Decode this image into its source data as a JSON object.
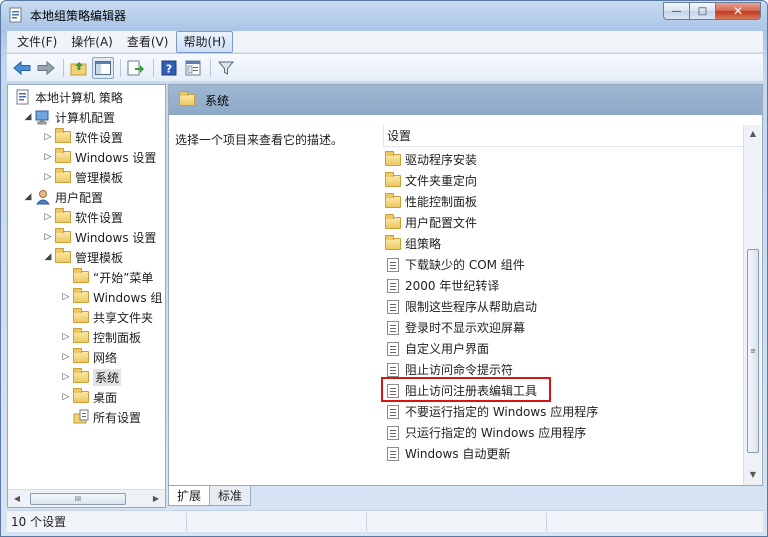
{
  "window": {
    "title": "本地组策略编辑器",
    "minimize_glyph": "—",
    "maximize_glyph": "□",
    "close_glyph": "✕"
  },
  "menubar": {
    "items": [
      "文件(F)",
      "操作(A)",
      "查看(V)",
      "帮助(H)"
    ]
  },
  "toolbar": {
    "icons": [
      "back-icon",
      "forward-icon",
      "up-folder-icon",
      "show-hide-tree-icon",
      "export-list-icon",
      "help-icon",
      "properties-icon",
      "filter-icon"
    ]
  },
  "tree": {
    "items": [
      {
        "label": "本地计算机 策略",
        "icon": "policy-doc-icon",
        "level": 0,
        "expanded": null
      },
      {
        "label": "计算机配置",
        "icon": "computer-icon",
        "level": 1,
        "expanded": true
      },
      {
        "label": "软件设置",
        "icon": "folder-icon",
        "level": 2,
        "expanded": false
      },
      {
        "label": "Windows 设置",
        "icon": "folder-icon",
        "level": 2,
        "expanded": false
      },
      {
        "label": "管理模板",
        "icon": "folder-icon",
        "level": 2,
        "expanded": false
      },
      {
        "label": "用户配置",
        "icon": "user-icon",
        "level": 1,
        "expanded": true
      },
      {
        "label": "软件设置",
        "icon": "folder-icon",
        "level": 2,
        "expanded": false
      },
      {
        "label": "Windows 设置",
        "icon": "folder-icon",
        "level": 2,
        "expanded": false
      },
      {
        "label": "管理模板",
        "icon": "folder-icon",
        "level": 2,
        "expanded": true
      },
      {
        "label": "“开始”菜单",
        "icon": "folder-icon",
        "level": 3,
        "expanded": null
      },
      {
        "label": "Windows 组",
        "icon": "folder-icon",
        "level": 3,
        "expanded": false
      },
      {
        "label": "共享文件夹",
        "icon": "folder-icon",
        "level": 3,
        "expanded": null
      },
      {
        "label": "控制面板",
        "icon": "folder-icon",
        "level": 3,
        "expanded": false
      },
      {
        "label": "网络",
        "icon": "folder-icon",
        "level": 3,
        "expanded": false
      },
      {
        "label": "系统",
        "icon": "folder-icon",
        "level": 3,
        "expanded": false,
        "selected": true
      },
      {
        "label": "桌面",
        "icon": "folder-icon",
        "level": 3,
        "expanded": false
      },
      {
        "label": "所有设置",
        "icon": "all-settings-icon",
        "level": 3,
        "expanded": null
      }
    ],
    "scroll_thumb_glyph": "III"
  },
  "content": {
    "header_title": "系统",
    "description": "选择一个项目来查看它的描述。",
    "column_header": "设置",
    "items": [
      {
        "label": "驱动程序安装",
        "type": "folder"
      },
      {
        "label": "文件夹重定向",
        "type": "folder"
      },
      {
        "label": "性能控制面板",
        "type": "folder"
      },
      {
        "label": "用户配置文件",
        "type": "folder"
      },
      {
        "label": "组策略",
        "type": "folder"
      },
      {
        "label": "下载缺少的 COM 组件",
        "type": "policy"
      },
      {
        "label": "2000 年世纪转译",
        "type": "policy"
      },
      {
        "label": "限制这些程序从帮助启动",
        "type": "policy"
      },
      {
        "label": "登录时不显示欢迎屏幕",
        "type": "policy"
      },
      {
        "label": "自定义用户界面",
        "type": "policy"
      },
      {
        "label": "阻止访问命令提示符",
        "type": "policy"
      },
      {
        "label": "阻止访问注册表编辑工具",
        "type": "policy",
        "highlighted": true
      },
      {
        "label": "不要运行指定的 Windows 应用程序",
        "type": "policy"
      },
      {
        "label": "只运行指定的 Windows 应用程序",
        "type": "policy"
      },
      {
        "label": "Windows 自动更新",
        "type": "policy"
      }
    ],
    "scroll_thumb_glyph": "≡"
  },
  "tabs": [
    "扩展",
    "标准"
  ],
  "statusbar": {
    "text": "10 个设置"
  },
  "colors": {
    "highlight_box": "#d81414",
    "header_band": "#9fb7d2"
  }
}
